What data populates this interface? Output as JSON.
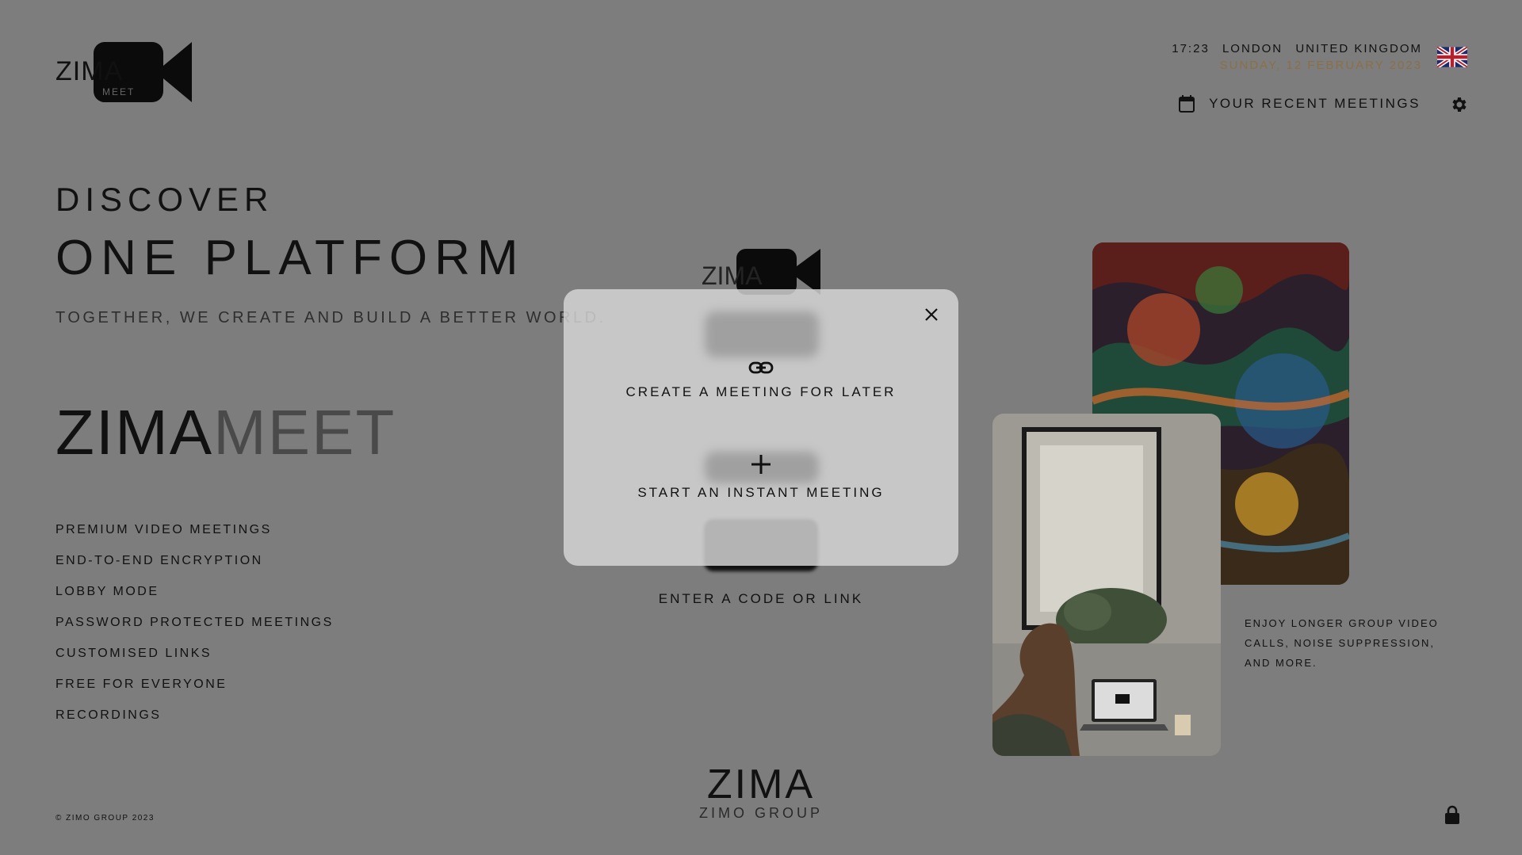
{
  "brand": {
    "logo_word": "ZIMA",
    "logo_sub": "MEET",
    "wordmark_primary": "ZIMA",
    "wordmark_secondary": "MEET"
  },
  "header": {
    "time": "17:23",
    "city": "LONDON",
    "country": "UNITED KINGDOM",
    "date": "SUNDAY, 12 FEBRUARY 2023",
    "recent_meetings_label": "YOUR RECENT MEETINGS",
    "icons": [
      "uk-flag-icon",
      "calendar-icon",
      "gear-icon"
    ]
  },
  "hero": {
    "eyebrow": "DISCOVER",
    "headline": "ONE PLATFORM",
    "tagline": "TOGETHER, WE CREATE AND BUILD A BETTER WORLD."
  },
  "features": [
    "PREMIUM VIDEO MEETINGS",
    "END-TO-END ENCRYPTION",
    "LOBBY MODE",
    "PASSWORD PROTECTED MEETINGS",
    "CUSTOMISED LINKS",
    "FREE FOR EVERYONE",
    "RECORDINGS"
  ],
  "center": {
    "enter_code_label": "ENTER A CODE OR LINK"
  },
  "promo_text": "ENJOY LONGER GROUP VIDEO CALLS, NOISE SUPPRESSION, AND MORE.",
  "footer": {
    "copyright": "© ZIMO GROUP 2023",
    "company_big": "ZIMA",
    "company_small": "ZIMO GROUP"
  },
  "modal": {
    "create_later_label": "CREATE A MEETING FOR LATER",
    "instant_label": "START AN INSTANT MEETING",
    "icons": [
      "link-icon",
      "plus-icon",
      "close-icon"
    ]
  },
  "colors": {
    "page_overlay": "#7d7d7d",
    "modal_bg": "#d8d8d8",
    "date_accent": "#8a6f47",
    "text": "#111111"
  }
}
